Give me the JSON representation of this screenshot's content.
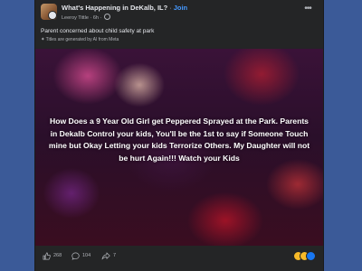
{
  "post": {
    "group_name": "What's Happening in DeKalb, IL?",
    "separator": "·",
    "join_label": "Join",
    "author": "Leeroy Tittle",
    "time": "6h",
    "ai_title": "Parent concerned about child safety at park",
    "ai_note": "Titles are generated by AI from Meta",
    "body_text": "How Does a 9 Year Old Girl get Peppered Sprayed at the Park. Parents in Dekalb Control your kids, You'll be the 1st to say if Someone Touch mine but Okay Letting your kids Terrorize Others. My Daughter will not be hurt Again!!! Watch your Kids"
  },
  "actions": {
    "like_count": "268",
    "comment_count": "104",
    "share_count": "7"
  },
  "icons": {
    "more": "more-horizontal-icon",
    "like": "thumbs-up-icon",
    "comment": "comment-icon",
    "share": "share-icon",
    "sparkle": "sparkle-icon",
    "globe": "globe-icon"
  },
  "colors": {
    "page_bg": "#3b5a98",
    "card_bg": "#242526",
    "text_primary": "#e4e6eb",
    "text_secondary": "#b0b3b8",
    "link": "#4599ff",
    "reaction_haha": "#f7b928",
    "reaction_sad": "#f7b928",
    "reaction_like": "#1877f2"
  }
}
